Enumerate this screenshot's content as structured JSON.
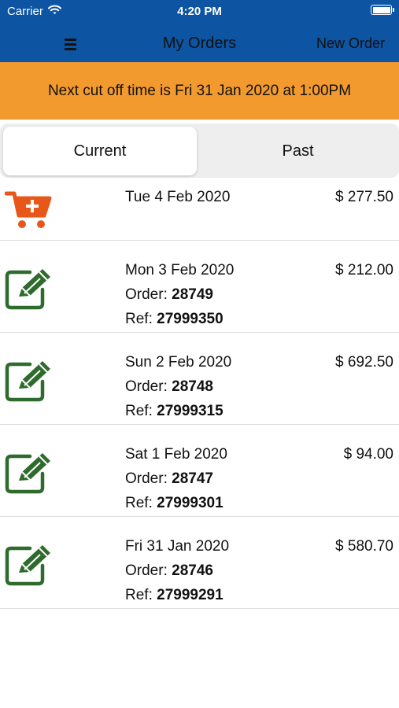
{
  "status_bar": {
    "carrier": "Carrier",
    "time": "4:20 PM"
  },
  "nav": {
    "title": "My Orders",
    "new_order_label": "New Order"
  },
  "banner": {
    "text": "Next cut off time is Fri 31 Jan 2020 at 1:00PM"
  },
  "tabs": {
    "current": "Current",
    "past": "Past"
  },
  "labels": {
    "order": "Order: ",
    "ref": "Ref: "
  },
  "orders": [
    {
      "date": "Tue 4 Feb 2020",
      "amount": "$ 277.50",
      "icon": "cart-add-icon"
    },
    {
      "date": "Mon 3 Feb 2020",
      "amount": "$ 212.00",
      "order": "28749",
      "ref": "27999350",
      "icon": "edit-icon"
    },
    {
      "date": "Sun 2 Feb 2020",
      "amount": "$ 692.50",
      "order": "28748",
      "ref": "27999315",
      "icon": "edit-icon"
    },
    {
      "date": "Sat 1 Feb 2020",
      "amount": "$ 94.00",
      "order": "28747",
      "ref": "27999301",
      "icon": "edit-icon"
    },
    {
      "date": "Fri 31 Jan 2020",
      "amount": "$ 580.70",
      "order": "28746",
      "ref": "27999291",
      "icon": "edit-icon"
    }
  ],
  "colors": {
    "header": "#0d54a2",
    "banner": "#f29a2e",
    "cart_icon": "#e8571a",
    "edit_icon": "#2e6b2c"
  }
}
